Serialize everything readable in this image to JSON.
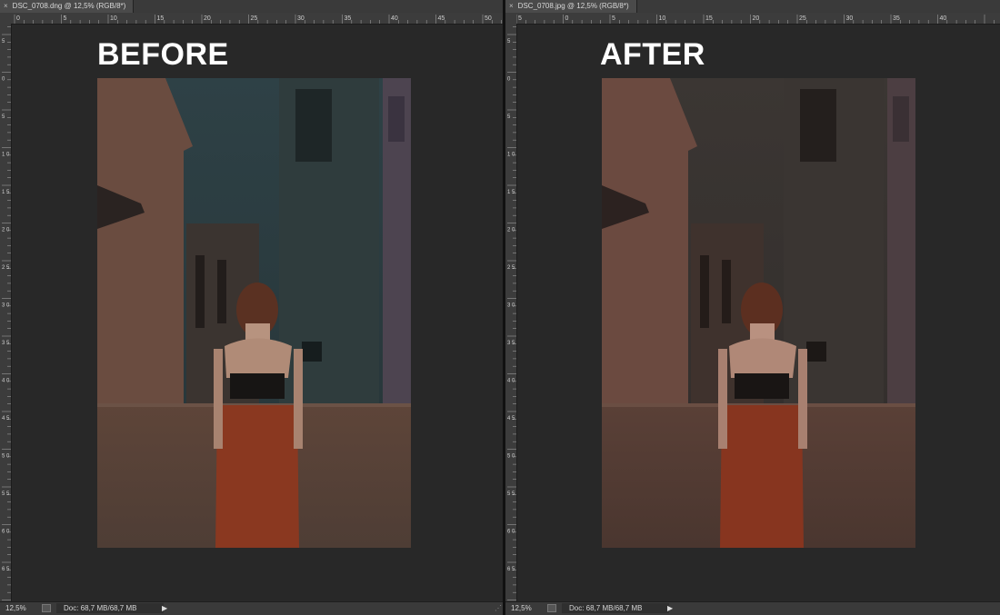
{
  "left": {
    "tab_title": "DSC_0708.dng @ 12,5% (RGB/8*)",
    "headline": "BEFORE",
    "zoom": "12,5%",
    "doc_info": "Doc: 68,7 MB/68,7 MB",
    "ruler_h": [
      "0",
      "5",
      "10",
      "15",
      "20",
      "25",
      "30",
      "35",
      "40",
      "45",
      "50"
    ],
    "ruler_v": [
      "5",
      "0",
      "5",
      "1 0",
      "1 5",
      "2 0",
      "2 5",
      "3 0",
      "3 5",
      "4 0",
      "4 5",
      "5 0",
      "5 5",
      "6 0",
      "6 5",
      "7"
    ]
  },
  "right": {
    "tab_title": "DSC_0708.jpg @ 12,5% (RGB/8*)",
    "headline": "AFTER",
    "zoom": "12,5%",
    "doc_info": "Doc: 68,7 MB/68,7 MB",
    "ruler_h": [
      "5",
      "0",
      "5",
      "10",
      "15",
      "20",
      "25",
      "30",
      "35",
      "40"
    ]
  },
  "icons": {
    "close": "×",
    "status_arrow": "▶",
    "resize": "⋰"
  },
  "colors": {
    "ui_dark": "#282828",
    "headline": "#ffffff"
  }
}
